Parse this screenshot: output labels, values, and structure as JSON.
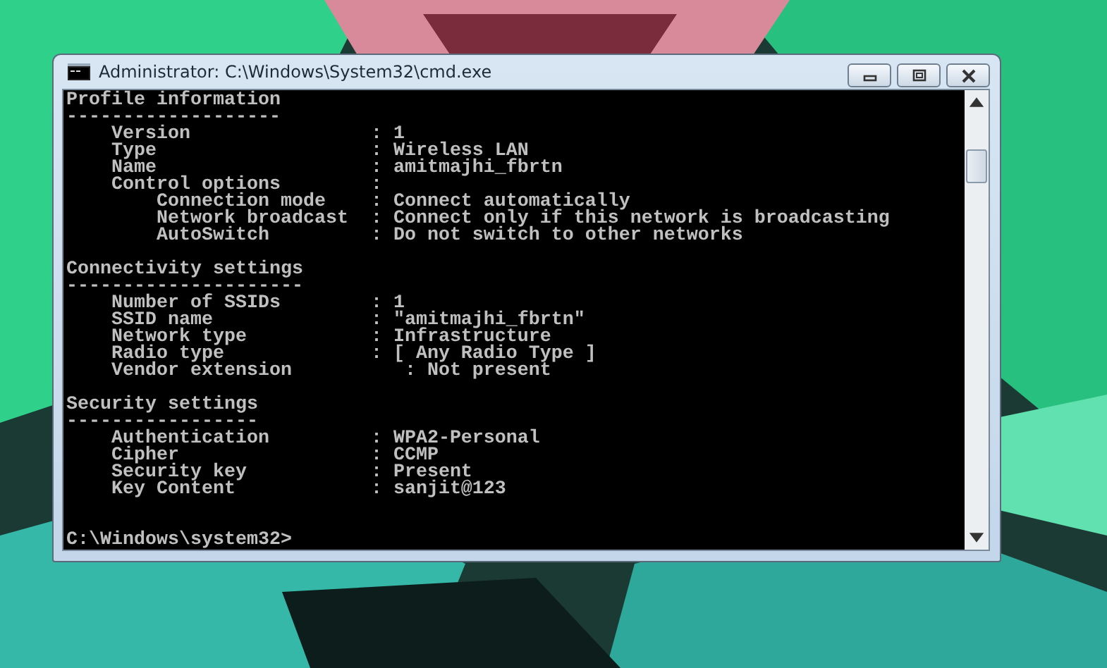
{
  "window": {
    "title": "Administrator: C:\\Windows\\System32\\cmd.exe"
  },
  "console": {
    "sections": [
      {
        "lines": [
          "Profile information",
          "-------------------",
          "    Version                : 1",
          "    Type                   : Wireless LAN",
          "    Name                   : amitmajhi_fbrtn",
          "    Control options        :",
          "        Connection mode    : Connect automatically",
          "        Network broadcast  : Connect only if this network is broadcasting",
          "        AutoSwitch         : Do not switch to other networks"
        ]
      },
      {
        "lines": [
          "Connectivity settings",
          "---------------------",
          "    Number of SSIDs        : 1",
          "    SSID name              : \"amitmajhi_fbrtn\"",
          "    Network type           : Infrastructure",
          "    Radio type             : [ Any Radio Type ]",
          "    Vendor extension          : Not present"
        ]
      },
      {
        "lines": [
          "Security settings",
          "-----------------",
          "    Authentication         : WPA2-Personal",
          "    Cipher                 : CCMP",
          "    Security key           : Present",
          "    Key Content            : sanjit@123"
        ]
      }
    ],
    "prompt": "C:\\Windows\\system32>"
  }
}
